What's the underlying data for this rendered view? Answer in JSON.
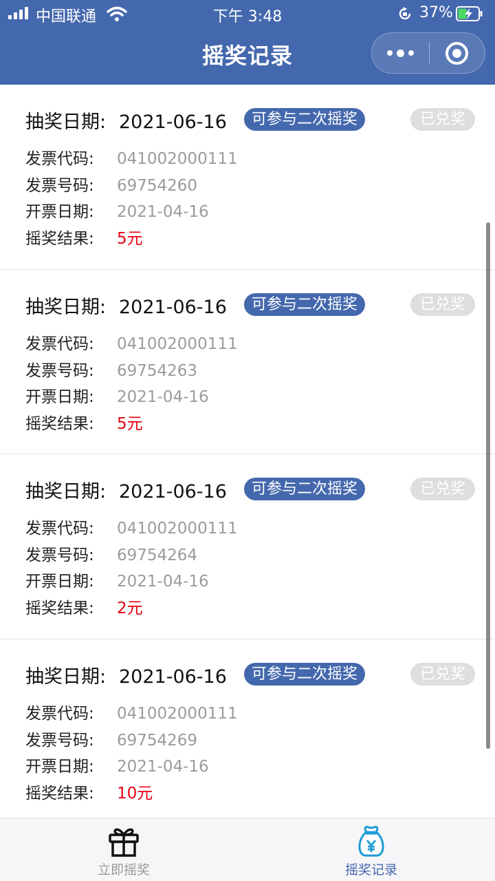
{
  "status_bar": {
    "carrier": "中国联通",
    "time": "下午 3:48",
    "battery": "37%"
  },
  "nav": {
    "title": "摇奖记录"
  },
  "labels": {
    "lottery_date": "抽奖日期:",
    "invoice_code": "发票代码:",
    "invoice_number": "发票号码:",
    "issue_date": "开票日期:",
    "result": "摇奖结果:",
    "second_draw": "可参与二次摇奖",
    "redeemed": "已兑奖"
  },
  "records": [
    {
      "lottery_date": "2021-06-16",
      "invoice_code": "041002000111",
      "invoice_number": "69754260",
      "issue_date": "2021-04-16",
      "result": "5元"
    },
    {
      "lottery_date": "2021-06-16",
      "invoice_code": "041002000111",
      "invoice_number": "69754263",
      "issue_date": "2021-04-16",
      "result": "5元"
    },
    {
      "lottery_date": "2021-06-16",
      "invoice_code": "041002000111",
      "invoice_number": "69754264",
      "issue_date": "2021-04-16",
      "result": "2元"
    },
    {
      "lottery_date": "2021-06-16",
      "invoice_code": "041002000111",
      "invoice_number": "69754269",
      "issue_date": "2021-04-16",
      "result": "10元"
    }
  ],
  "tabbar": {
    "draw_label": "立即摇奖",
    "records_label": "摇奖记录"
  },
  "colors": {
    "primary": "#4468ad",
    "prize": "#e60012",
    "muted": "#9b9b9b"
  }
}
